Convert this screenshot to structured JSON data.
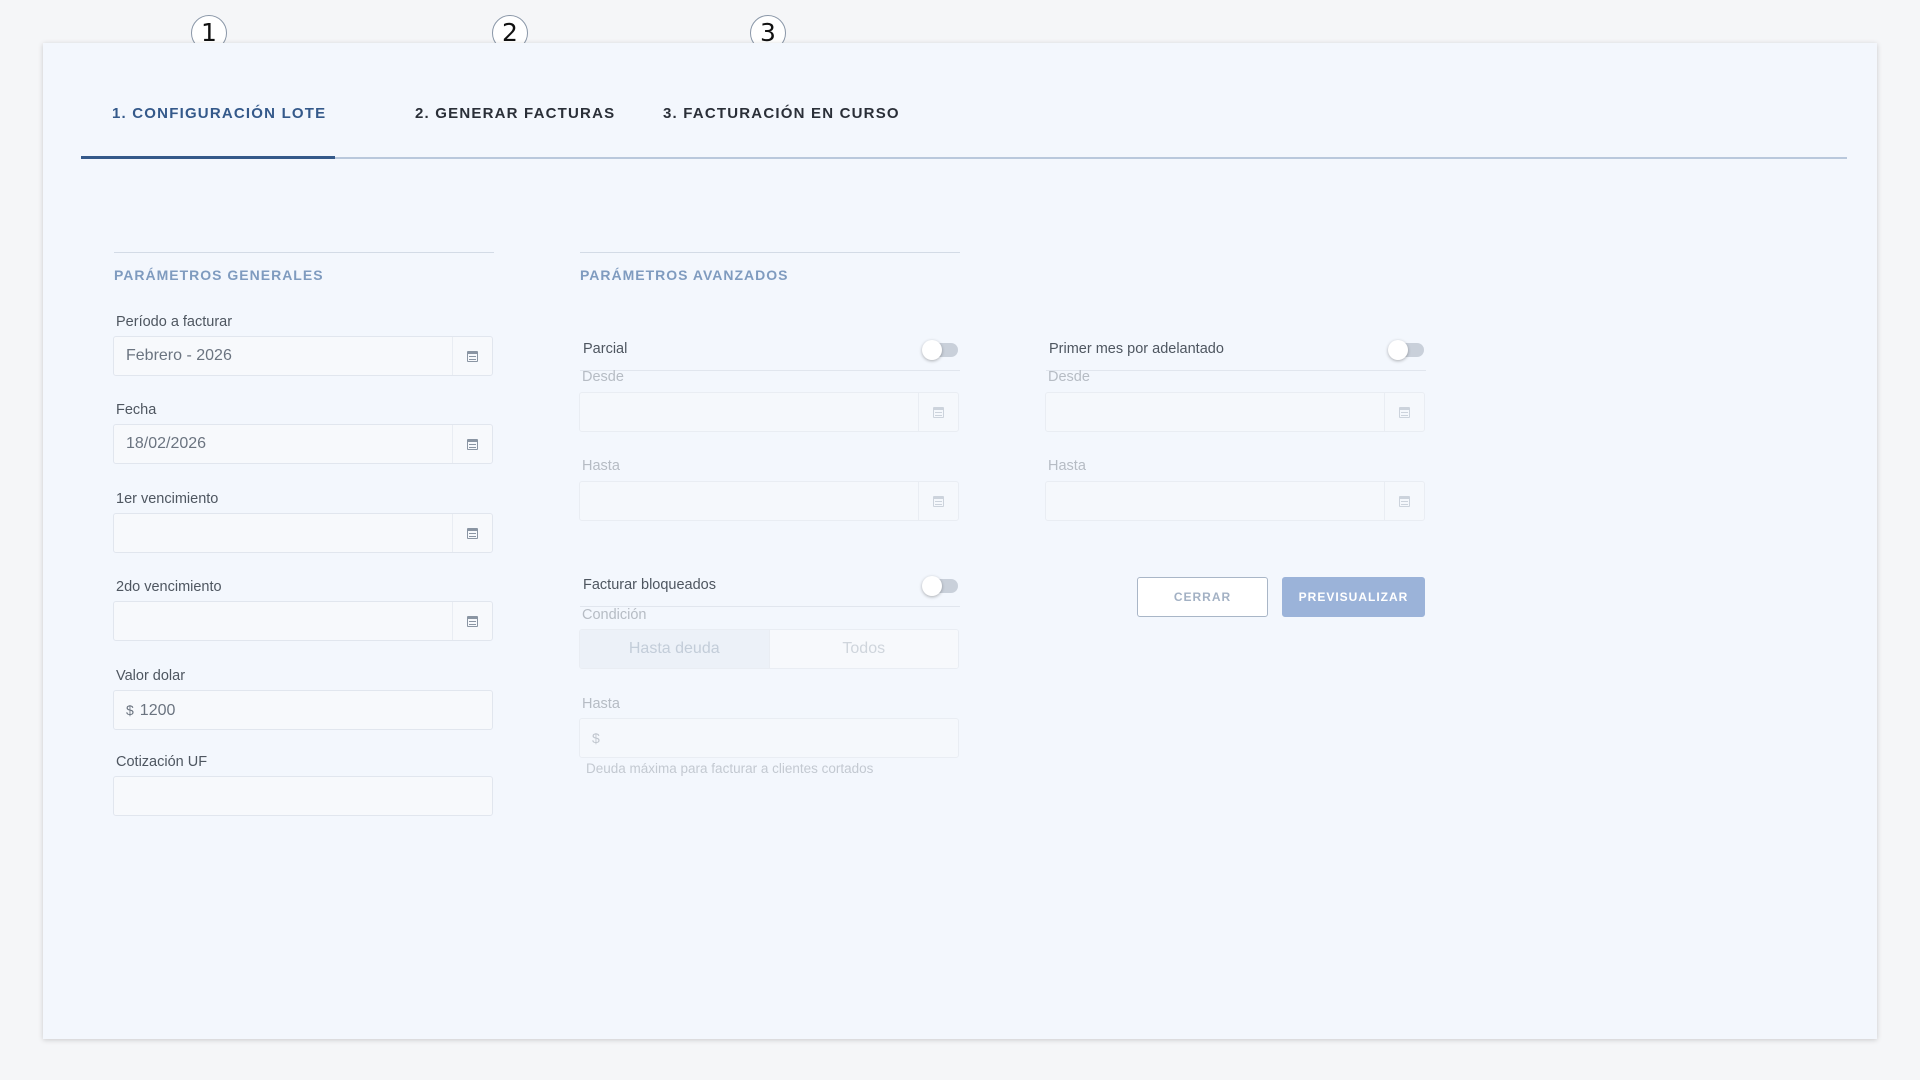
{
  "steps": [
    {
      "number": "1",
      "label": "1. CONFIGURACIÓN LOTE"
    },
    {
      "number": "2",
      "label": "2. GENERAR FACTURAS"
    },
    {
      "number": "3",
      "label": "3. FACTURACIÓN EN CURSO"
    }
  ],
  "general": {
    "title": "PARÁMETROS GENERALES",
    "periodo": {
      "label": "Período a facturar",
      "value": "Febrero - 2026"
    },
    "fecha": {
      "label": "Fecha",
      "value": "18/02/2026"
    },
    "venc1": {
      "label": "1er vencimiento",
      "value": ""
    },
    "venc2": {
      "label": "2do vencimiento",
      "value": ""
    },
    "dolar": {
      "label": "Valor dolar",
      "prefix": "$",
      "value": "1200"
    },
    "uf": {
      "label": "Cotización UF",
      "value": ""
    }
  },
  "advanced": {
    "title": "PARÁMETROS AVANZADOS",
    "parcial": {
      "label": "Parcial",
      "desde": "Desde",
      "hasta": "Hasta"
    },
    "primer_mes": {
      "label": "Primer mes por adelantado",
      "desde": "Desde",
      "hasta": "Hasta"
    },
    "bloqueados": {
      "label": "Facturar bloqueados"
    },
    "condicion": {
      "label": "Condición",
      "options": [
        "Hasta deuda",
        "Todos"
      ]
    },
    "hasta_deuda": {
      "label": "Hasta",
      "prefix": "$",
      "hint": "Deuda máxima para facturar a clientes cortados"
    }
  },
  "actions": {
    "close": "CERRAR",
    "preview": "PREVISUALIZAR"
  }
}
